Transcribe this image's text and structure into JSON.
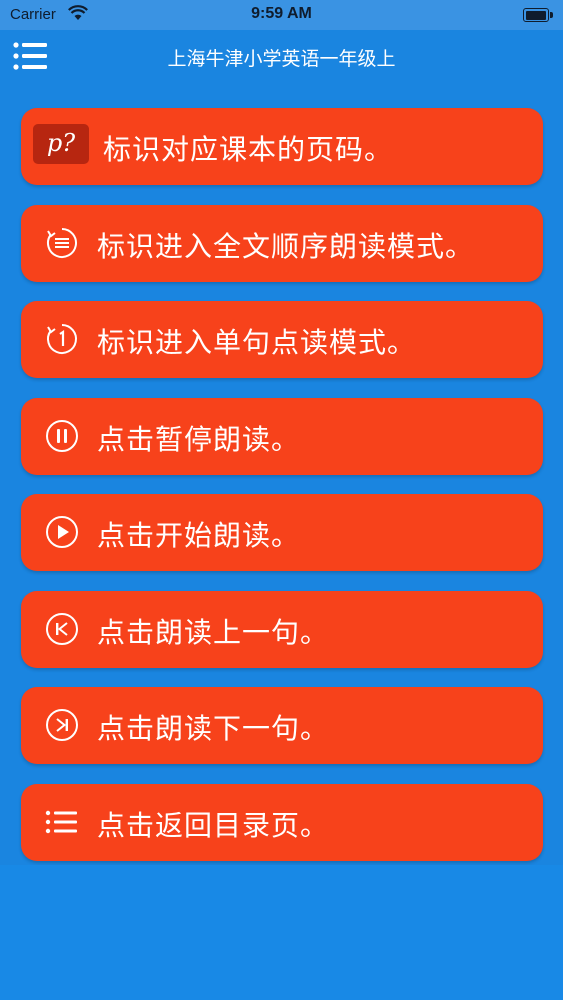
{
  "status_bar": {
    "carrier": "Carrier",
    "time": "9:59 AM",
    "battery_level": 1.0
  },
  "nav": {
    "title": "上海牛津小学英语一年级上",
    "menu_icon": "list-menu-icon"
  },
  "items": [
    {
      "badge": "p?",
      "label": "标识对应课本的页码。",
      "icon": "page-badge-icon"
    },
    {
      "label": "标识进入全文顺序朗读模式。",
      "icon": "sequential-read-icon"
    },
    {
      "label": "标识进入单句点读模式。",
      "icon": "single-sentence-icon"
    },
    {
      "label": "点击暂停朗读。",
      "icon": "pause-icon"
    },
    {
      "label": "点击开始朗读。",
      "icon": "play-icon"
    },
    {
      "label": "点击朗读上一句。",
      "icon": "previous-icon"
    },
    {
      "label": "点击朗读下一句。",
      "icon": "next-icon"
    },
    {
      "label": "点击返回目录页。",
      "icon": "list-icon"
    }
  ],
  "colors": {
    "background": "#1a85e0",
    "button": "#f7421b",
    "badge": "#b72610",
    "text": "#ffffff"
  }
}
